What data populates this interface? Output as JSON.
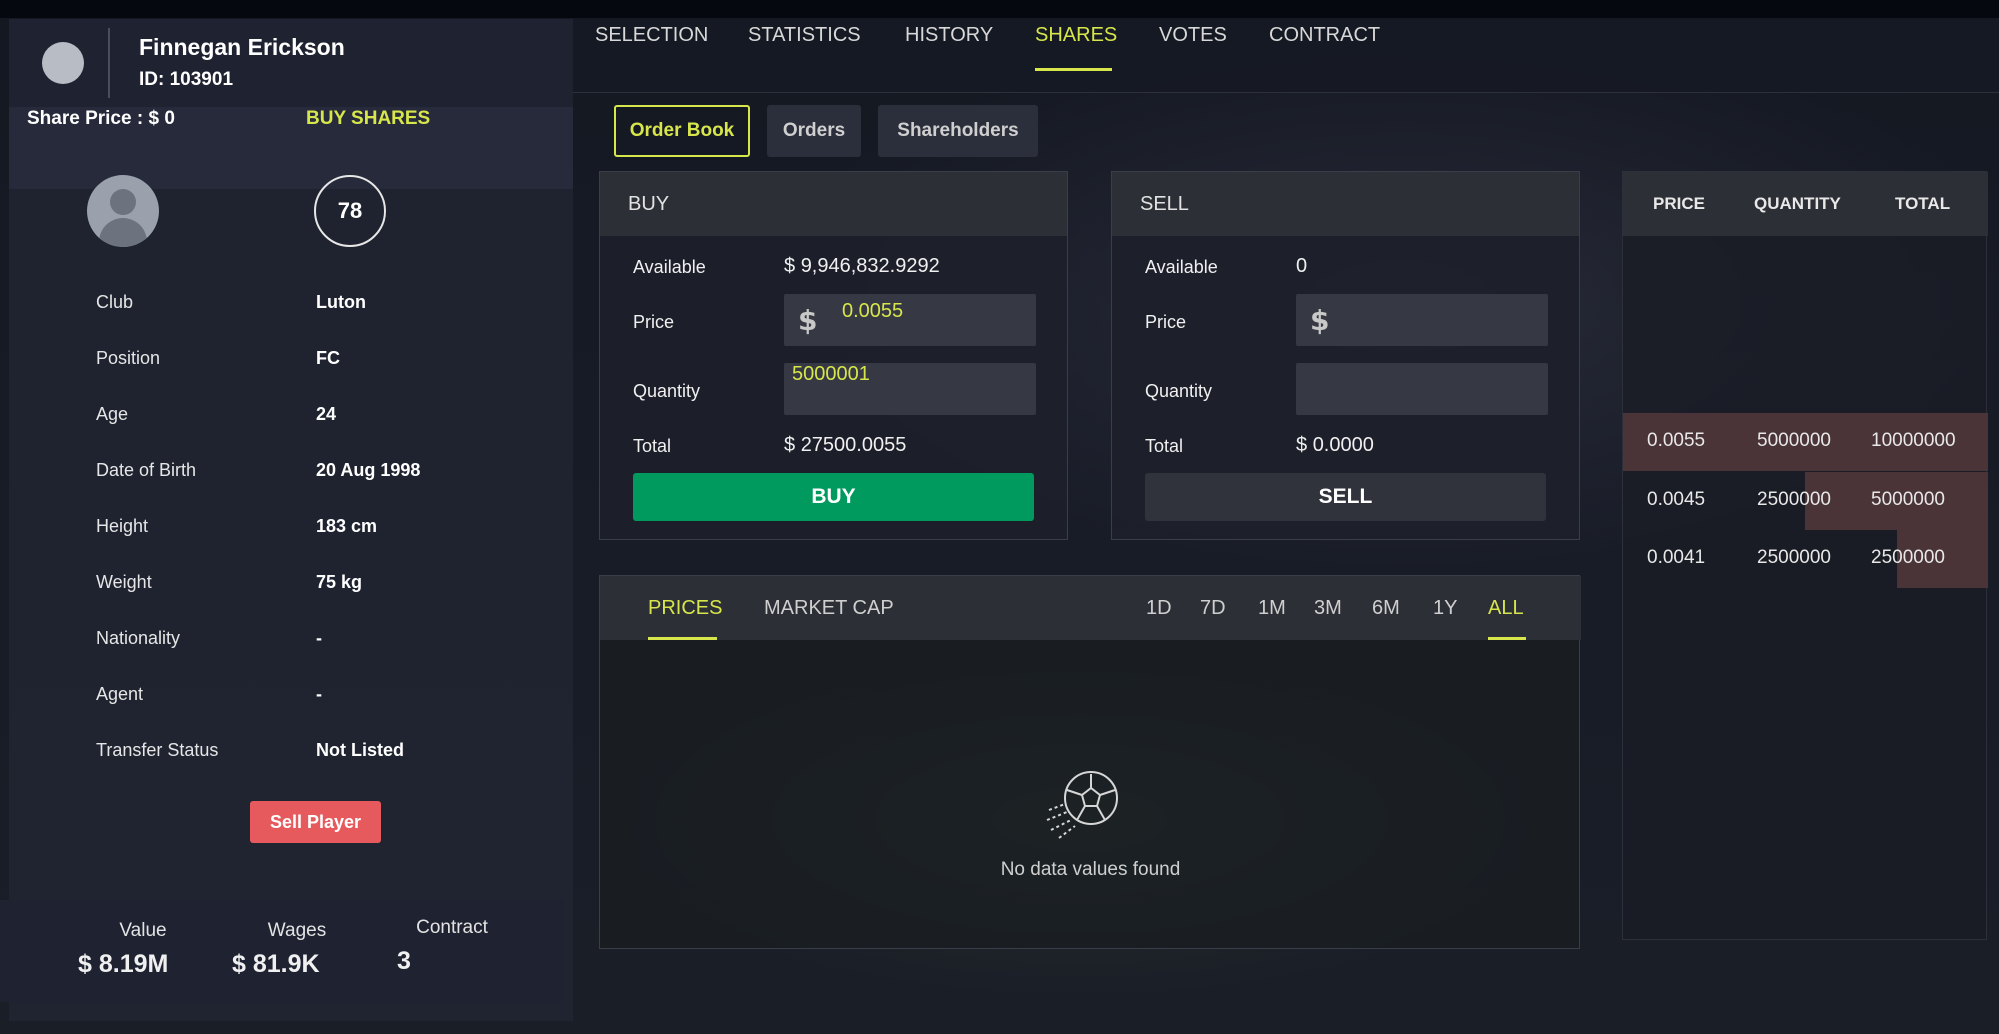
{
  "player": {
    "name": "Finnegan Erickson",
    "id_text": "ID: 103901",
    "share_price_label": "Share Price :",
    "share_price_value": "0",
    "buy_shares_label": "BUY SHARES",
    "rating": "78",
    "details": [
      {
        "key": "Club",
        "value": "Luton"
      },
      {
        "key": "Position",
        "value": "FC"
      },
      {
        "key": "Age",
        "value": "24"
      },
      {
        "key": "Date of Birth",
        "value": "20 Aug 1998"
      },
      {
        "key": "Height",
        "value": "183 cm"
      },
      {
        "key": "Weight",
        "value": "75 kg"
      },
      {
        "key": "Nationality",
        "value": "-"
      },
      {
        "key": "Agent",
        "value": "-"
      },
      {
        "key": "Transfer Status",
        "value": "Not Listed"
      }
    ],
    "sell_player_label": "Sell Player",
    "footer": {
      "value_label": "Value",
      "value": "8.19M",
      "wages_label": "Wages",
      "wages": "81.9K",
      "contract_label": "Contract",
      "contract": "3"
    }
  },
  "currency_icon": "dollar-coin-icon",
  "nav": {
    "tabs": [
      "SELECTION",
      "STATISTICS",
      "HISTORY",
      "SHARES",
      "VOTES",
      "CONTRACT"
    ],
    "active": "SHARES"
  },
  "subtabs": {
    "items": [
      "Order Book",
      "Orders",
      "Shareholders"
    ],
    "active": "Order Book"
  },
  "buy": {
    "title": "BUY",
    "available_label": "Available",
    "available": "9,946,832.9292",
    "price_label": "Price",
    "price": "0.0055",
    "quantity_label": "Quantity",
    "quantity": "5000001",
    "total_label": "Total",
    "total": "27500.0055",
    "button": "BUY"
  },
  "sell": {
    "title": "SELL",
    "available_label": "Available",
    "available": "0",
    "price_label": "Price",
    "price": "",
    "quantity_label": "Quantity",
    "quantity": "",
    "total_label": "Total",
    "total": "0.0000",
    "button": "SELL"
  },
  "order_table": {
    "headers": [
      "PRICE",
      "QUANTITY",
      "TOTAL"
    ],
    "rows": [
      {
        "price": "0.0055",
        "quantity": "5000000",
        "total": "10000000",
        "depth_fraction": 1.0
      },
      {
        "price": "0.0045",
        "quantity": "2500000",
        "total": "5000000",
        "depth_fraction": 0.5
      },
      {
        "price": "0.0041",
        "quantity": "2500000",
        "total": "2500000",
        "depth_fraction": 0.25
      }
    ]
  },
  "chart": {
    "tabs": [
      "PRICES",
      "MARKET CAP"
    ],
    "active_tab": "PRICES",
    "ranges": [
      "1D",
      "7D",
      "1M",
      "3M",
      "6M",
      "1Y",
      "ALL"
    ],
    "active_range": "ALL",
    "empty_message": "No data values found"
  },
  "colors": {
    "accent": "#d7e64a",
    "buy_green": "#009a5e",
    "sell_red": "#e65a5d"
  }
}
